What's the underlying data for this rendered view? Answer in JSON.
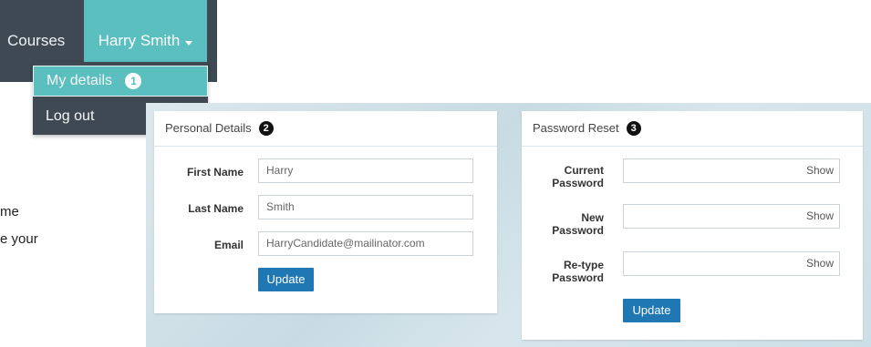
{
  "nav": {
    "courses": "Courses",
    "user_name": "Harry Smith"
  },
  "dropdown": {
    "my_details": "My details",
    "my_details_badge": "1",
    "log_out": "Log out"
  },
  "side_text": {
    "line1": "me",
    "line2": "e your"
  },
  "personal": {
    "title": "Personal Details",
    "badge": "2",
    "first_name_label": "First Name",
    "first_name_value": "Harry",
    "last_name_label": "Last Name",
    "last_name_value": "Smith",
    "email_label": "Email",
    "email_value": "HarryCandidate@mailinator.com",
    "update_label": "Update"
  },
  "password": {
    "title": "Password Reset",
    "badge": "3",
    "current_label_1": "Current",
    "current_label_2": "Password",
    "new_label_1": "New",
    "new_label_2": "Password",
    "retype_label_1": "Re-type",
    "retype_label_2": "Password",
    "show_label": "Show",
    "update_label": "Update"
  },
  "colors": {
    "nav_dark": "#3f4953",
    "accent_teal": "#5bbfbf",
    "button_blue": "#1f78b4"
  }
}
